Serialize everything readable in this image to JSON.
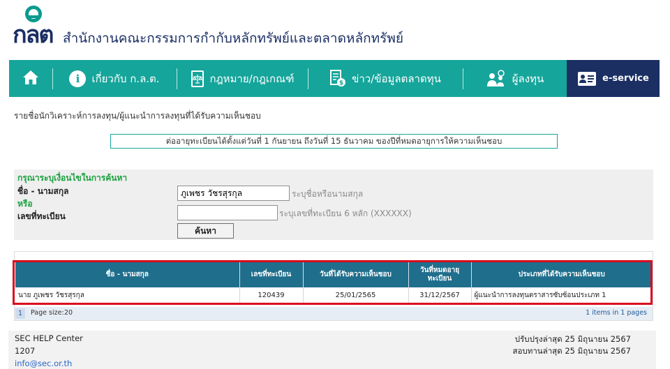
{
  "header": {
    "logo_text": "กลต",
    "org_name": "สำนักงานคณะกรรมการกำกับหลักทรัพย์และตลาดหลักทรัพย์"
  },
  "nav": {
    "home_icon": "home-icon",
    "items": [
      {
        "label": "เกี่ยวกับ ก.ล.ต.",
        "icon": "info-icon"
      },
      {
        "label": "กฎหมาย/กฎเกณฑ์",
        "icon": "law-book-icon"
      },
      {
        "label": "ข่าว/ข้อมูลตลาดทุน",
        "icon": "news-money-icon"
      },
      {
        "label": "ผู้ลงทุน",
        "icon": "investor-icon"
      }
    ],
    "eservice": {
      "label": "e-service",
      "icon": "id-card-icon"
    }
  },
  "page": {
    "title": "รายชื่อนักวิเคราะห์การลงทุน/ผู้แนะนำการลงทุนที่ได้รับความเห็นชอบ",
    "notice": "ต่ออายุทะเบียนได้ตั้งแต่วันที่ 1 กันยายน ถึงวันที่ 15 ธันวาคม ของปีที่หมดอายุการให้ความเห็นชอบ"
  },
  "search": {
    "hint": "กรุณาระบุเงื่อนไขในการค้นหา",
    "name_label": "ชื่อ - นามสกุล",
    "name_value": "ภูเพชร วัชรสุรกุล",
    "name_help": "ระบุชื่อหรือนามสกุล",
    "or_label": "หรือ",
    "reg_label": "เลขที่ทะเบียน",
    "reg_value": "",
    "reg_help": "ระบุเลขที่ทะเบียน 6 หลัก (XXXXXX)",
    "button": "ค้นหา"
  },
  "results": {
    "columns": [
      "ชื่อ - นามสกุล",
      "เลขที่ทะเบียน",
      "วันที่ได้รับความเห็นชอบ",
      "วันที่หมดอายุทะเบียน",
      "ประเภทที่ได้รับความเห็นชอบ"
    ],
    "column_4_line1": "วันที่หมดอายุ",
    "column_4_line2": "ทะเบียน",
    "rows": [
      {
        "name": "นาย ภูเพชร วัชรสุรกุล",
        "reg_no": "120439",
        "approved": "25/01/2565",
        "expires": "31/12/2567",
        "type": "ผู้แนะนำการลงทุนตราสารซับซ้อนประเภท 1"
      }
    ],
    "highlight_color": "#d90b1e"
  },
  "pager": {
    "page": "1",
    "page_size_label": "Page size:",
    "page_size": "20",
    "info": "1 items in 1 pages"
  },
  "footer": {
    "help_center": "SEC HELP Center",
    "phone": "1207",
    "email": "info@sec.or.th",
    "updated": "ปรับปรุงล่าสุด 25 มิถุนายน 2567",
    "reviewed": "สอบทานล่าสุด 25 มิถุนายน 2567"
  }
}
